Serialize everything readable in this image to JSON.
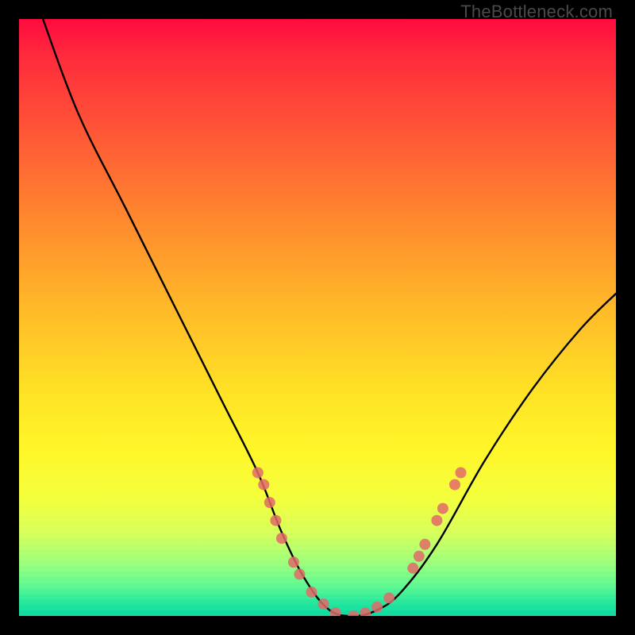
{
  "watermark": {
    "text": "TheBottleneck.com"
  },
  "chart_data": {
    "type": "line",
    "title": "",
    "xlabel": "",
    "ylabel": "",
    "xlim": [
      0,
      100
    ],
    "ylim": [
      0,
      100
    ],
    "grid": false,
    "legend": false,
    "series": [
      {
        "name": "bottleneck-curve",
        "x": [
          4,
          10,
          18,
          26,
          34,
          40,
          44,
          48,
          52,
          56,
          60,
          64,
          70,
          78,
          86,
          94,
          100
        ],
        "y": [
          100,
          84,
          68,
          52,
          36,
          24,
          14,
          6,
          1,
          0,
          1,
          4,
          12,
          26,
          38,
          48,
          54
        ]
      }
    ],
    "markers": {
      "name": "highlighted-points",
      "color": "#e26a6a",
      "points": [
        {
          "x": 40,
          "y": 24
        },
        {
          "x": 41,
          "y": 22
        },
        {
          "x": 42,
          "y": 19
        },
        {
          "x": 43,
          "y": 16
        },
        {
          "x": 44,
          "y": 13
        },
        {
          "x": 46,
          "y": 9
        },
        {
          "x": 47,
          "y": 7
        },
        {
          "x": 49,
          "y": 4
        },
        {
          "x": 51,
          "y": 2
        },
        {
          "x": 53,
          "y": 0.5
        },
        {
          "x": 56,
          "y": 0
        },
        {
          "x": 58,
          "y": 0.5
        },
        {
          "x": 60,
          "y": 1.5
        },
        {
          "x": 62,
          "y": 3
        },
        {
          "x": 66,
          "y": 8
        },
        {
          "x": 67,
          "y": 10
        },
        {
          "x": 68,
          "y": 12
        },
        {
          "x": 70,
          "y": 16
        },
        {
          "x": 71,
          "y": 18
        },
        {
          "x": 73,
          "y": 22
        },
        {
          "x": 74,
          "y": 24
        }
      ]
    },
    "gradient_stops": [
      {
        "pos": 0,
        "color": "#ff0b3f"
      },
      {
        "pos": 20,
        "color": "#ff5a36"
      },
      {
        "pos": 48,
        "color": "#ffb829"
      },
      {
        "pos": 72,
        "color": "#fff629"
      },
      {
        "pos": 91,
        "color": "#9bff78"
      },
      {
        "pos": 100,
        "color": "#0fd9a0"
      }
    ]
  }
}
